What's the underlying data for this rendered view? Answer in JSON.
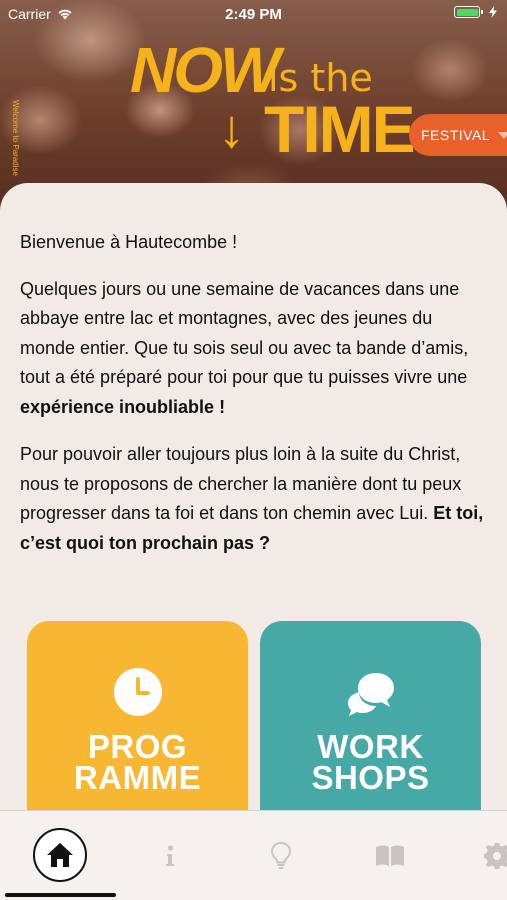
{
  "status_bar": {
    "carrier": "Carrier",
    "time": "2:49 PM"
  },
  "header": {
    "logo_now": "NOW",
    "logo_is_the": "is the",
    "logo_time": "TIME",
    "logo_arrow": "↓",
    "side_text": "Welcome to Paradise",
    "festival_label": "FESTIVAL"
  },
  "content": {
    "greeting": "Bienvenue à Hautecombe !",
    "paragraph1": "Quelques jours ou une semaine de vacances dans une abbaye entre lac et montagnes, avec des jeunes du monde entier. Que tu sois seul ou avec ta bande d’amis, tout a été préparé pour toi pour que tu puisses vivre une ",
    "paragraph1_bold": "expérience inoubliable !",
    "paragraph2": "Pour pouvoir aller toujours plus loin à la suite du Christ, nous te proposons de chercher la manière dont tu peux progresser dans ta foi et dans ton chemin avec Lui. ",
    "paragraph2_bold": "Et toi, c’est quoi ton prochain pas ?"
  },
  "tiles": {
    "programme_line1": "PROG",
    "programme_line2": "RAMME",
    "workshops_line1": "WORK",
    "workshops_line2": "SHOPS"
  },
  "tab_bar": {
    "items": [
      "home",
      "info",
      "idea",
      "book",
      "settings"
    ],
    "active": "home"
  },
  "colors": {
    "accent_yellow": "#f7b732",
    "accent_teal": "#47a9a5",
    "festival_orange": "#e8602a",
    "background": "#f2ebe5"
  }
}
